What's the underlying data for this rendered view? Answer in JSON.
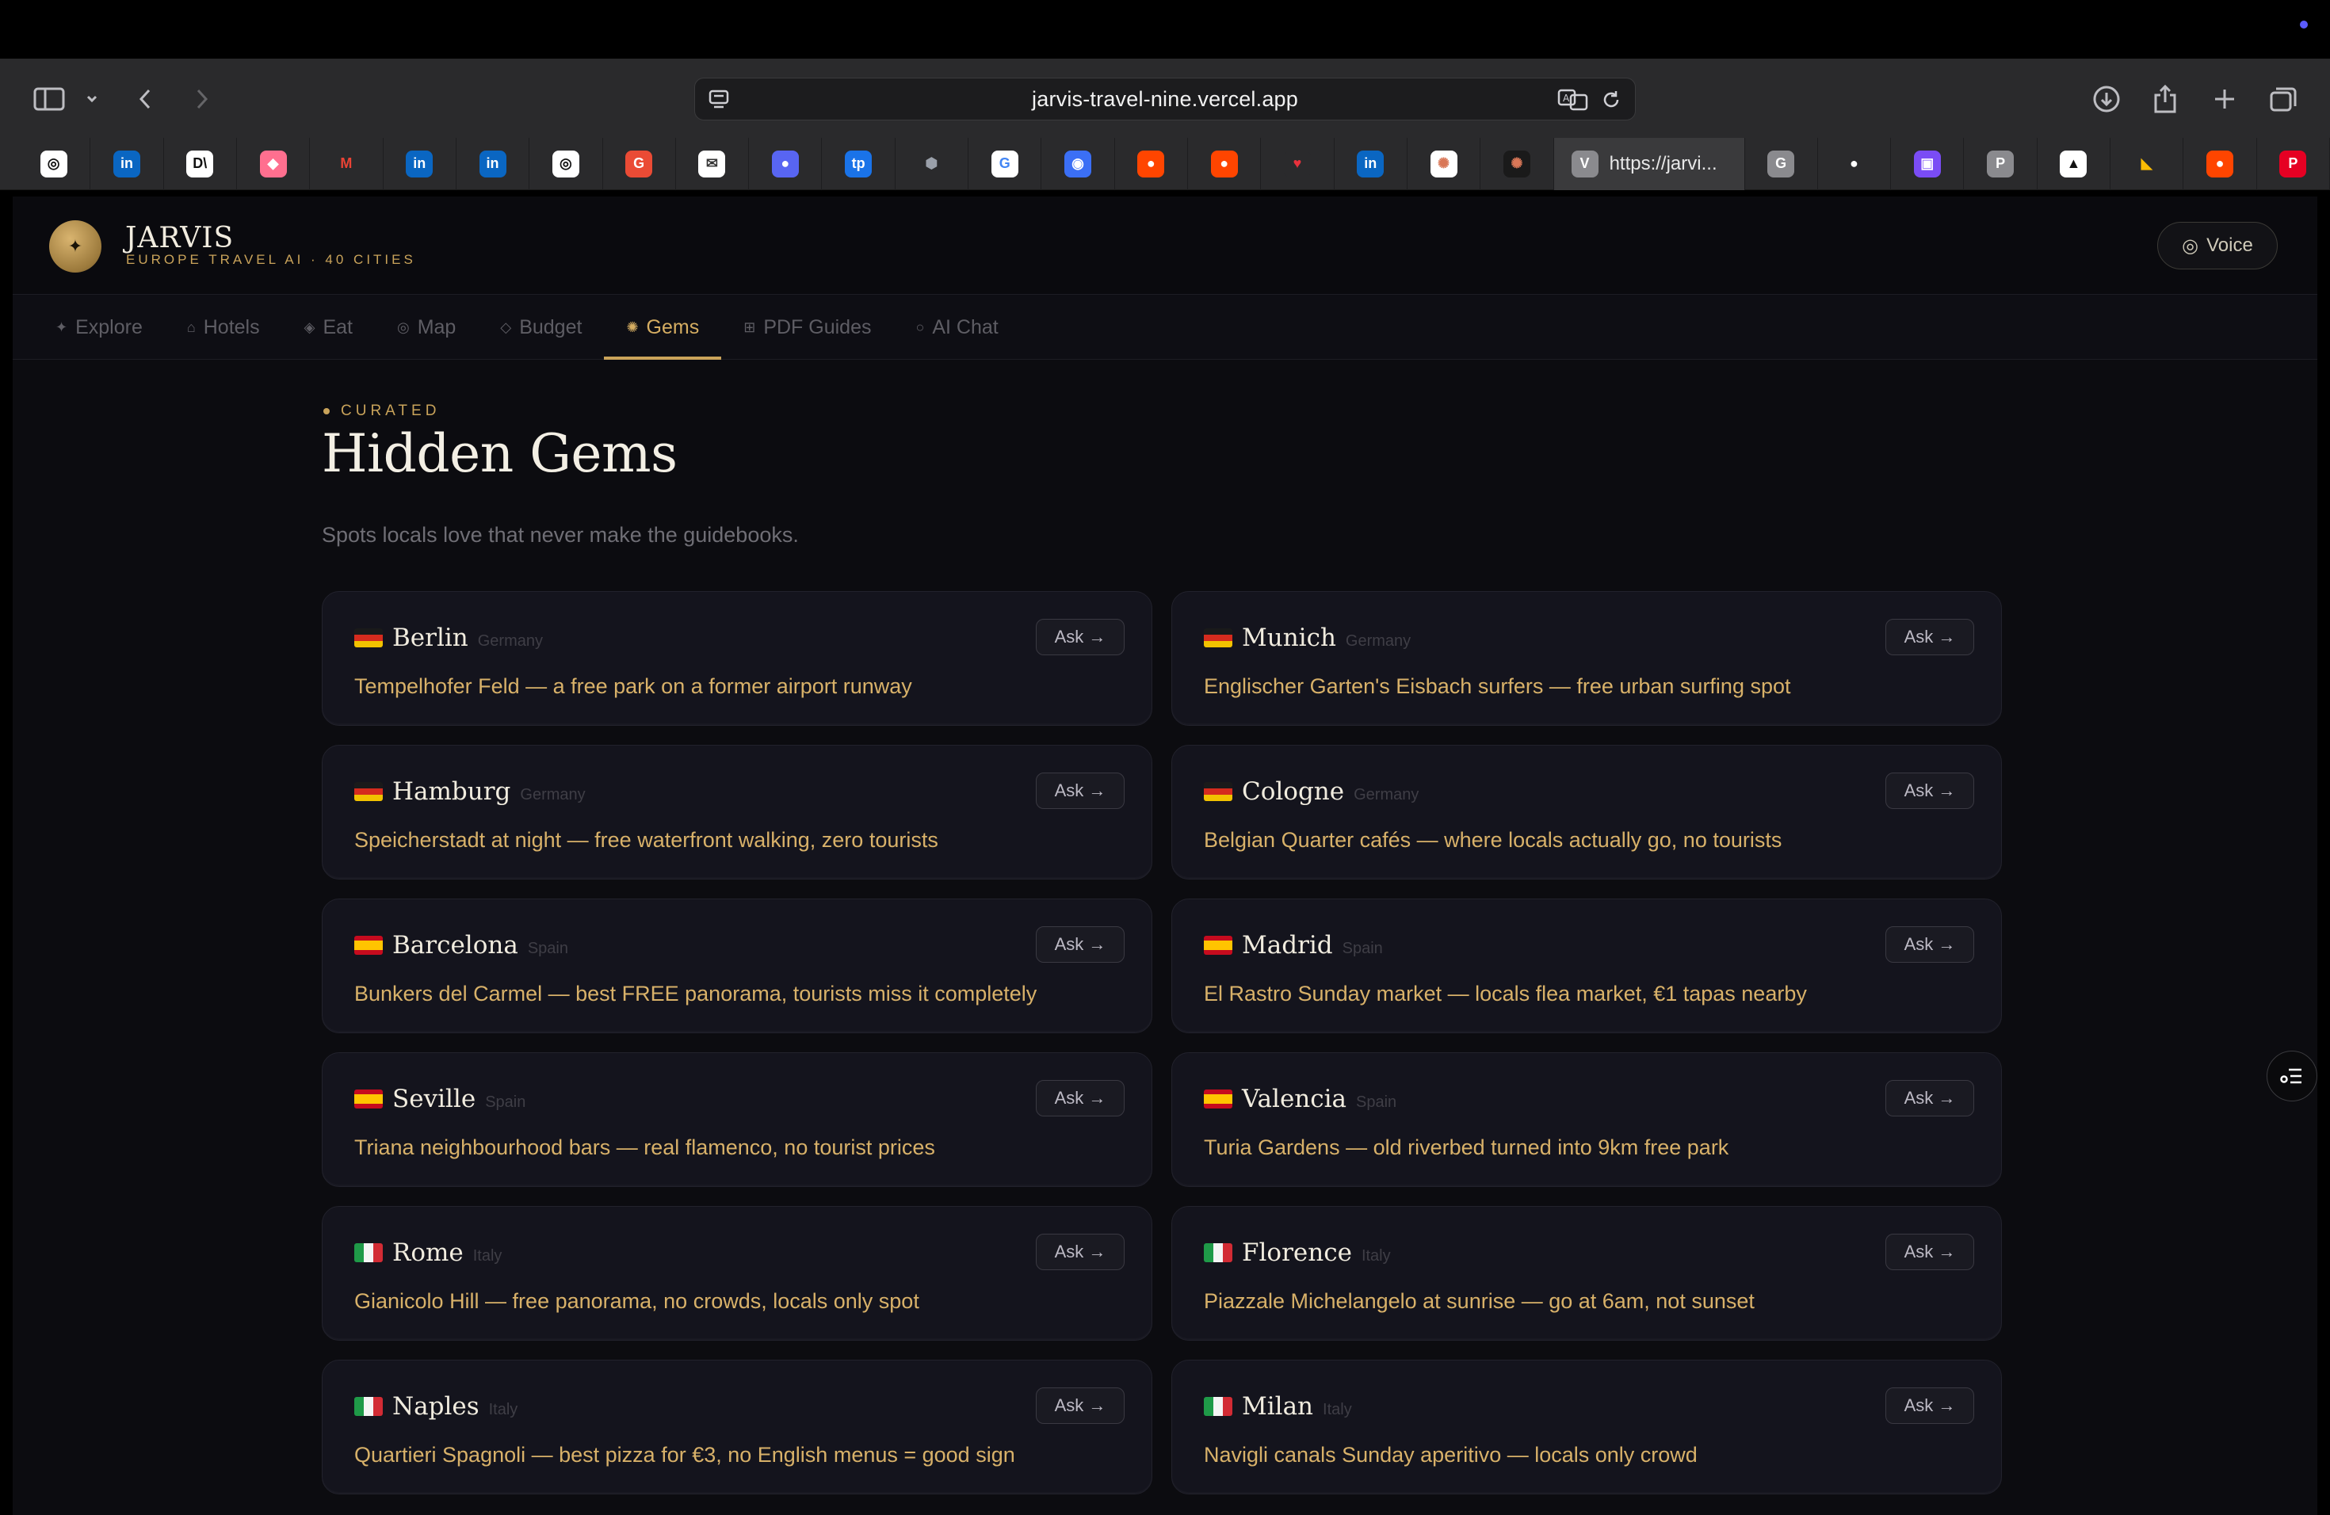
{
  "browser": {
    "url": "jarvis-travel-nine.vercel.app",
    "active_tab_title": "https://jarvi...",
    "bookmarks": [
      {
        "icon": "openai-icon",
        "glyph": "◎",
        "color": "#ffffff",
        "fg": "#111111"
      },
      {
        "icon": "linkedin-icon",
        "glyph": "in",
        "color": "#0a66c2",
        "fg": "#ffffff"
      },
      {
        "icon": "dl-icon",
        "glyph": "D\\",
        "color": "#ffffff",
        "fg": "#111111"
      },
      {
        "icon": "eraser-icon",
        "glyph": "◆",
        "color": "#ff6f8f",
        "fg": "#ffffff"
      },
      {
        "icon": "gmail-icon",
        "glyph": "M",
        "color": "#2a2a2c",
        "fg": "#ea4335"
      },
      {
        "icon": "linkedin-icon",
        "glyph": "in",
        "color": "#0a66c2",
        "fg": "#ffffff"
      },
      {
        "icon": "linkedin-icon",
        "glyph": "in",
        "color": "#0a66c2",
        "fg": "#ffffff"
      },
      {
        "icon": "openai-icon",
        "glyph": "◎",
        "color": "#ffffff",
        "fg": "#111111"
      },
      {
        "icon": "g-app-icon",
        "glyph": "G",
        "color": "#ea4b35",
        "fg": "#ffffff"
      },
      {
        "icon": "mail-icon",
        "glyph": "✉",
        "color": "#ffffff",
        "fg": "#333333"
      },
      {
        "icon": "discord-icon",
        "glyph": "●",
        "color": "#5865f2",
        "fg": "#ffffff"
      },
      {
        "icon": "tp-icon",
        "glyph": "tp",
        "color": "#1a73e8",
        "fg": "#ffffff"
      },
      {
        "icon": "cube-icon",
        "glyph": "⬢",
        "color": "#2a2a2c",
        "fg": "#9aa0aa"
      },
      {
        "icon": "google-icon",
        "glyph": "G",
        "color": "#ffffff",
        "fg": "#4285f4"
      },
      {
        "icon": "chat-icon",
        "glyph": "◉",
        "color": "#3b6ff5",
        "fg": "#ffffff"
      },
      {
        "icon": "reddit-icon",
        "glyph": "●",
        "color": "#ff4500",
        "fg": "#ffffff"
      },
      {
        "icon": "reddit-icon",
        "glyph": "●",
        "color": "#ff4500",
        "fg": "#ffffff"
      },
      {
        "icon": "heart-icon",
        "glyph": "♥",
        "color": "#2a2a2c",
        "fg": "#e8313c"
      },
      {
        "icon": "linkedin-icon",
        "glyph": "in",
        "color": "#0a66c2",
        "fg": "#ffffff"
      },
      {
        "icon": "claude-icon",
        "glyph": "✺",
        "color": "#ffffff",
        "fg": "#d97757"
      },
      {
        "icon": "claude-icon",
        "glyph": "✺",
        "color": "#1a1a1a",
        "fg": "#d97757"
      },
      {
        "icon": "grammarly-icon",
        "glyph": "G",
        "color": "#8a8a8e",
        "fg": "#ffffff"
      },
      {
        "icon": "github-icon",
        "glyph": "●",
        "color": "#2a2a2c",
        "fg": "#ffffff"
      },
      {
        "icon": "slides-icon",
        "glyph": "▣",
        "color": "#7a4cf5",
        "fg": "#ffffff"
      },
      {
        "icon": "p-icon",
        "glyph": "P",
        "color": "#8a8a8e",
        "fg": "#ffffff"
      },
      {
        "icon": "arc-icon",
        "glyph": "▲",
        "color": "#ffffff",
        "fg": "#111111"
      },
      {
        "icon": "drive-icon",
        "glyph": "◣",
        "color": "#2a2a2c",
        "fg": "#fbbc04"
      },
      {
        "icon": "reddit-icon",
        "glyph": "●",
        "color": "#ff4500",
        "fg": "#ffffff"
      },
      {
        "icon": "pinterest-icon",
        "glyph": "P",
        "color": "#e60023",
        "fg": "#ffffff"
      }
    ]
  },
  "app": {
    "brand_title": "JARVIS",
    "brand_subtitle": "EUROPE TRAVEL AI · 40 CITIES",
    "voice_label": "Voice",
    "tabs": [
      {
        "icon": "✦",
        "label": "Explore",
        "name": "tab-explore",
        "active": false
      },
      {
        "icon": "⌂",
        "label": "Hotels",
        "name": "tab-hotels",
        "active": false
      },
      {
        "icon": "◈",
        "label": "Eat",
        "name": "tab-eat",
        "active": false
      },
      {
        "icon": "◎",
        "label": "Map",
        "name": "tab-map",
        "active": false
      },
      {
        "icon": "◇",
        "label": "Budget",
        "name": "tab-budget",
        "active": false
      },
      {
        "icon": "✺",
        "label": "Gems",
        "name": "tab-gems",
        "active": true
      },
      {
        "icon": "⊞",
        "label": "PDF Guides",
        "name": "tab-pdf-guides",
        "active": false
      },
      {
        "icon": "○",
        "label": "AI Chat",
        "name": "tab-ai-chat",
        "active": false
      }
    ],
    "accent_color": "#c9a35a"
  },
  "page": {
    "kicker": "CURATED",
    "title": "Hidden Gems",
    "subtitle": "Spots locals love that never make the guidebooks.",
    "ask_label": "Ask →",
    "gems": [
      {
        "flag": "de",
        "city": "Berlin",
        "country": "Germany",
        "tip": "Tempelhofer Feld — a free park on a former airport runway"
      },
      {
        "flag": "de",
        "city": "Munich",
        "country": "Germany",
        "tip": "Englischer Garten's Eisbach surfers — free urban surfing spot"
      },
      {
        "flag": "de",
        "city": "Hamburg",
        "country": "Germany",
        "tip": "Speicherstadt at night — free waterfront walking, zero tourists"
      },
      {
        "flag": "de",
        "city": "Cologne",
        "country": "Germany",
        "tip": "Belgian Quarter cafés — where locals actually go, no tourists"
      },
      {
        "flag": "es",
        "city": "Barcelona",
        "country": "Spain",
        "tip": "Bunkers del Carmel — best FREE panorama, tourists miss it completely"
      },
      {
        "flag": "es",
        "city": "Madrid",
        "country": "Spain",
        "tip": "El Rastro Sunday market — locals flea market, €1 tapas nearby"
      },
      {
        "flag": "es",
        "city": "Seville",
        "country": "Spain",
        "tip": "Triana neighbourhood bars — real flamenco, no tourist prices"
      },
      {
        "flag": "es",
        "city": "Valencia",
        "country": "Spain",
        "tip": "Turia Gardens — old riverbed turned into 9km free park"
      },
      {
        "flag": "it",
        "city": "Rome",
        "country": "Italy",
        "tip": "Gianicolo Hill — free panorama, no crowds, locals only spot"
      },
      {
        "flag": "it",
        "city": "Florence",
        "country": "Italy",
        "tip": "Piazzale Michelangelo at sunrise — go at 6am, not sunset"
      },
      {
        "flag": "it",
        "city": "Naples",
        "country": "Italy",
        "tip": "Quartieri Spagnoli — best pizza for €3, no English menus = good sign"
      },
      {
        "flag": "it",
        "city": "Milan",
        "country": "Italy",
        "tip": "Navigli canals Sunday aperitivo — locals only crowd"
      }
    ]
  }
}
